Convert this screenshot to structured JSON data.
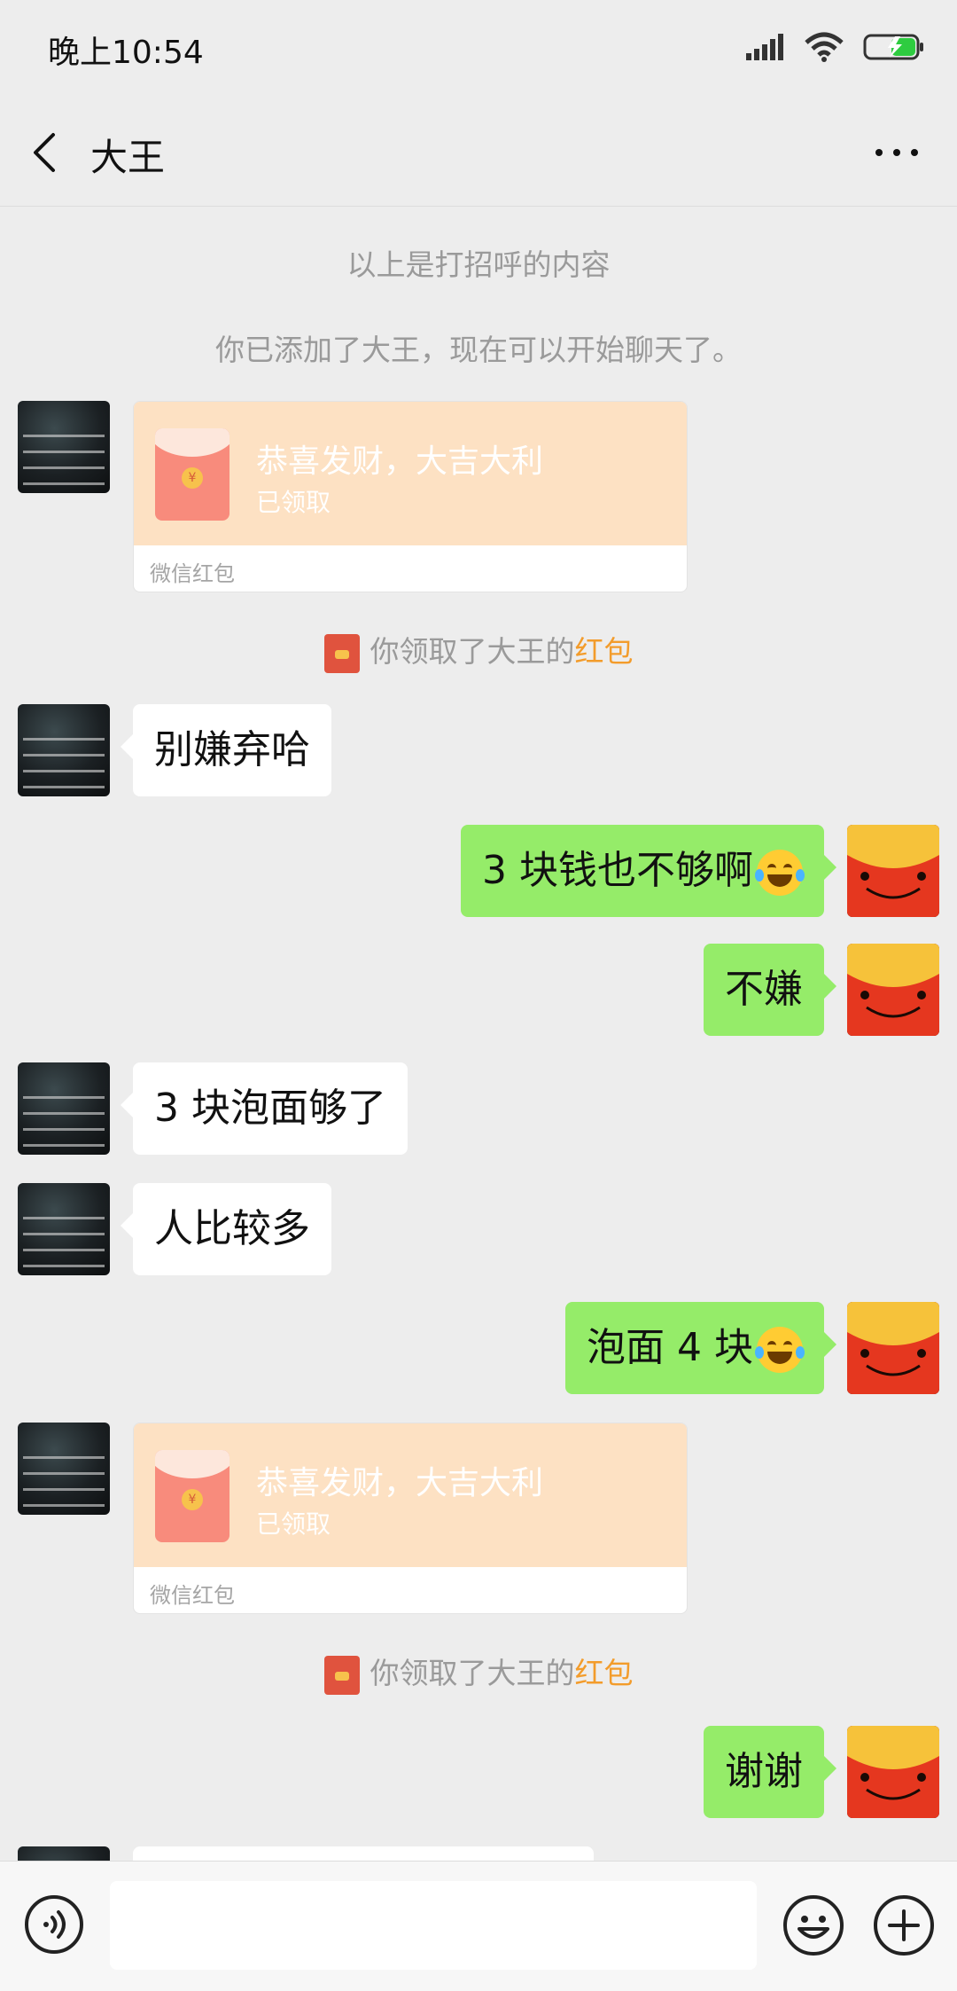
{
  "status_bar": {
    "time": "晚上10:54"
  },
  "header": {
    "title": "大王"
  },
  "chat": {
    "system_messages": [
      "以上是打招呼的内容",
      "你已添加了大王，现在可以开始聊天了。"
    ],
    "red_packets": [
      {
        "title": "恭喜发财，大吉大利",
        "status": "已领取",
        "footer": "微信红包"
      },
      {
        "title": "恭喜发财，大吉大利",
        "status": "已领取",
        "footer": "微信红包"
      }
    ],
    "received_note": {
      "prefix": "你领取了大王的",
      "link": "红包"
    },
    "messages": [
      {
        "side": "left",
        "text": "别嫌弃哈"
      },
      {
        "side": "right",
        "text": "3 块钱也不够啊"
      },
      {
        "side": "right",
        "text": "不嫌"
      },
      {
        "side": "left",
        "text": "3 块泡面够了"
      },
      {
        "side": "left",
        "text": "人比较多"
      },
      {
        "side": "right",
        "text": "泡面 4 块"
      },
      {
        "side": "right",
        "text": "谢谢"
      }
    ]
  },
  "icons": {
    "back": "back-arrow-icon",
    "more": "more-icon",
    "voice": "voice-icon",
    "emoji": "emoji-icon",
    "plus": "plus-icon"
  },
  "colors": {
    "bg": "#ededed",
    "sent_bubble": "#95ec69",
    "received_bubble": "#ffffff",
    "red_packet": "#fde1c3",
    "link": "#f39c2b"
  }
}
